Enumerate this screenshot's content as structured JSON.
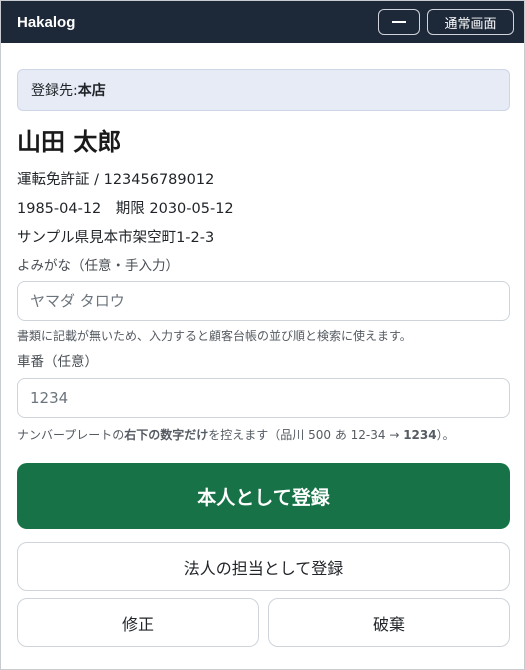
{
  "app": {
    "title": "Hakalog",
    "minimize_icon": "minimize-icon",
    "normal_view_label": "通常画面"
  },
  "registration": {
    "destination_label": "登録先: ",
    "destination_value": "本店"
  },
  "person": {
    "name": "山田 太郎",
    "id_line": "運転免許証 / 123456789012",
    "dates_line": "1985-04-12　期限 2030-05-12",
    "address": "サンプル県見本市架空町1-2-3"
  },
  "furigana": {
    "label": "よみがな（任意・手入力）",
    "placeholder": "ヤマダ タロウ",
    "value": "",
    "help": "書類に記載が無いため、入力すると顧客台帳の並び順と検索に使えます。"
  },
  "car_number": {
    "label": "車番（任意）",
    "placeholder": "1234",
    "value": "",
    "help_prefix": "ナンバープレートの",
    "help_bold": "右下の数字だけ",
    "help_middle": "を控えます（品川 500 あ 12-34 → ",
    "help_example": "1234",
    "help_suffix": "）。"
  },
  "actions": {
    "register_self": "本人として登録",
    "register_corporate": "法人の担当として登録",
    "edit": "修正",
    "discard": "破棄"
  },
  "colors": {
    "titlebar_bg": "#1d2838",
    "primary_green": "#177347",
    "dest_bg": "#e6ebf5"
  }
}
